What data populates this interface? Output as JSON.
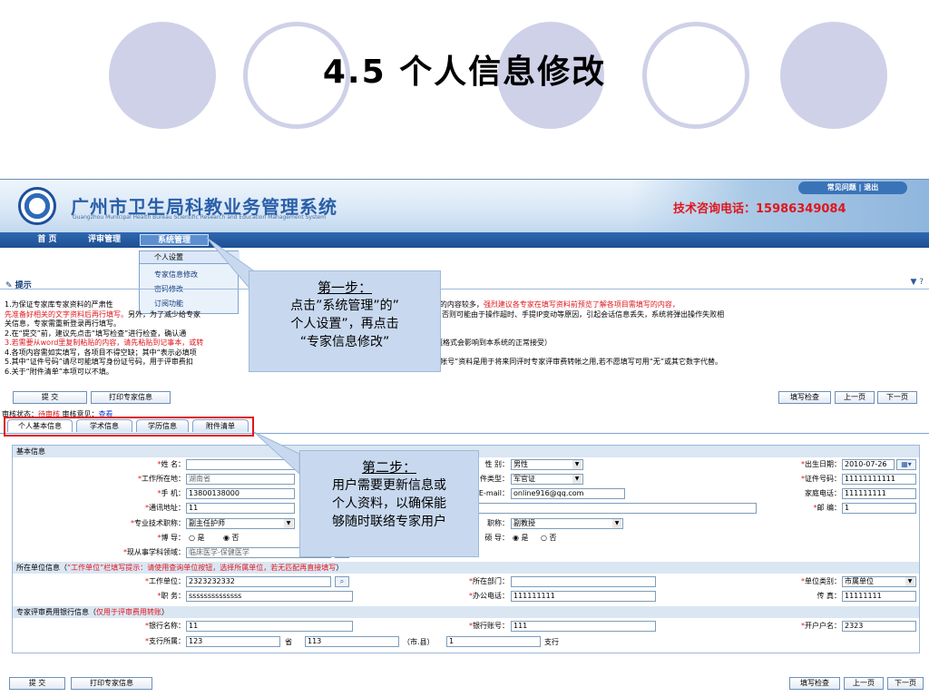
{
  "slide": {
    "title": "4.5 个人信息修改"
  },
  "header": {
    "system_name": "广州市卫生局科教业务管理系统",
    "system_name_en": "Guangzhou Municipal Health Bureau Scientific Research and Education Management System",
    "hotline": "技术咨询电话：15986349084",
    "top_links": "常见问题 | 退出"
  },
  "nav": {
    "items": [
      "首 页",
      "评审管理",
      "系统管理"
    ],
    "dropdown": [
      "个人设置",
      "专家信息修改",
      "密码修改",
      "订阅功能"
    ]
  },
  "tip": {
    "label": "提示",
    "icons": "▼  ?"
  },
  "tips": {
    "line1_a": "1.为保证专家库专家资料的严肃性",
    "line1_b": "的项目后才能“提交”，同时，本系统要求填写的内容较多，",
    "line1_red": "强烈建议各专家在填写资料前预览了解各项目需填写的内容，",
    "line2_red": "先准备好相关的文字资料后再行填写。",
    "line2_a": "另外，为了减少给专家",
    "line2_b": "进行填报（大段文字通过复制），否则可能由于操作超时、手提IP变动等原因，引起会话信息丢失，系统将弹出操作失败相",
    "line3": "关信息，专家需重新登录再行填写。",
    "line4": "2.在“提交”前，建议先点击“填写检查”进行检查，确认通",
    "line5_red": "3.若需要从word里复制粘贴的内容，请先粘贴到记事本，或转",
    "line5_b": "word里有一些隐藏格式会影响到本系统的正常接受）",
    "line6": "4.各项内容需如实填写，各项目不得空缺；其中“表示必填项",
    "line7_a": "5.其中“证件号码”请尽可能填写身份证号码，用于评审费扣",
    "line7_b": "型；“银行帐号”资料是用于将来同评时专家评审费转帐之用,若不愿填写可用“无”或其它数字代替。",
    "line8": "6.关于“附件清单”本项可以不填。"
  },
  "buttons": {
    "submit": "提 交",
    "print": "打印专家信息",
    "check": "填写检查",
    "prev": "上一页",
    "next": "下一页"
  },
  "status": {
    "prefix": "审核状态：",
    "state": "待审核",
    "opinion_label": "审核意见：",
    "opinion_link": "查看"
  },
  "tabs": [
    "个人基本信息",
    "学术信息",
    "学历信息",
    "附件清单"
  ],
  "form": {
    "sec_basic": "基本信息",
    "name_label": "姓 名：",
    "gender_label": "性 别：",
    "gender_value": "男性",
    "birth_label": "出生日期：",
    "birth_value": "2010-07-26",
    "region_label": "工作所在地：",
    "region_value": "湖南省",
    "idtype_label": "件类型：",
    "idtype_value": "军官证",
    "idno_label": "证件号码：",
    "idno_value": "11111111111",
    "mobile_label": "手 机：",
    "mobile_value": "13800138000",
    "email_label": "E-mail：",
    "email_value": "online916@qq.com",
    "homephone_label": "家庭电话：",
    "homephone_value": "111111111",
    "address_label": "通讯地址：",
    "address_value": "11",
    "zip_label": "邮 编：",
    "zip_value": "1",
    "title_label": "专业技术职称：",
    "title_value": "副主任护师",
    "teach_label": "职称：",
    "teach_value": "副教授",
    "phd_label": "博 导：",
    "phd_yes": "○ 是",
    "phd_no": "◉ 否",
    "master_label": "硕 导：",
    "master_yes": "◉ 是",
    "master_no": "○ 否",
    "field_label": "现从事学科领域：",
    "field_value": "临床医学-保健医学",
    "sec_unit_a": "所在单位信息（",
    "sec_unit_red": "“工作单位”栏填写提示：请使用查询单位按钮，选择所属单位，若无匹配再直接填写",
    "sec_unit_b": "）",
    "unit_label": "工作单位：",
    "unit_value": "2323232332",
    "dept_label": "所在部门：",
    "dept_value": "",
    "unittype_label": "单位类别：",
    "unittype_value": "市属单位",
    "duty_label": "职 务：",
    "duty_value": "ssssssssssssss",
    "office_label": "办公电话：",
    "office_value": "111111111",
    "fax_label": "传 真：",
    "fax_value": "11111111",
    "sec_bank_a": "专家评审费用银行信息（",
    "sec_bank_red": "仅用于评审费用转账",
    "sec_bank_b": "）",
    "bank_label": "银行名称：",
    "bank_value": "11",
    "account_label": "银行账号：",
    "account_value": "111",
    "holder_label": "开户户名：",
    "holder_value": "2323",
    "branch_label": "支行所属：",
    "branch_province": "123",
    "province_unit": "省",
    "branch_city": "113",
    "city_unit": "（市.县）",
    "branch_name": "1",
    "branch_unit": "支行"
  },
  "callouts": {
    "step1_title": "第一步：",
    "step1_body": [
      "点击”系统管理”的”",
      "个人设置”，再点击",
      "“专家信息修改”"
    ],
    "step2_title": "第二步：",
    "step2_body": [
      "用户需要更新信息或",
      "个人资料，以确保能",
      "够随时联络专家用户"
    ]
  }
}
